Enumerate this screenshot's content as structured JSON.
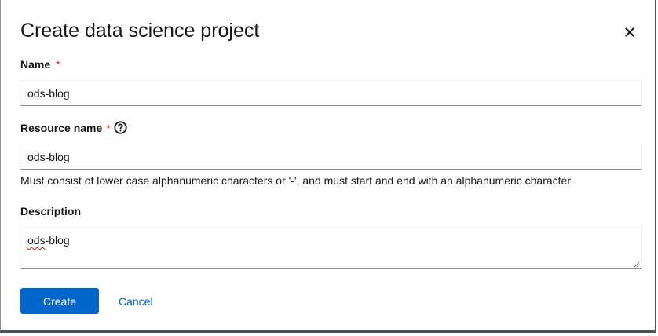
{
  "modal": {
    "title": "Create data science project",
    "close_icon": "close-icon"
  },
  "form": {
    "name": {
      "label": "Name",
      "required_marker": "*",
      "value": "ods-blog"
    },
    "resource_name": {
      "label": "Resource name",
      "required_marker": "*",
      "help_icon": "question-circle-icon",
      "value": "ods-blog",
      "helper_text": "Must consist of lower case alphanumeric characters or '-', and must start and end with an alphanumeric character"
    },
    "description": {
      "label": "Description",
      "value_prefix": "ods",
      "value_suffix": "-blog"
    }
  },
  "actions": {
    "create_label": "Create",
    "cancel_label": "Cancel"
  },
  "colors": {
    "primary": "#0066cc",
    "required": "#c9190b",
    "text": "#151515"
  }
}
